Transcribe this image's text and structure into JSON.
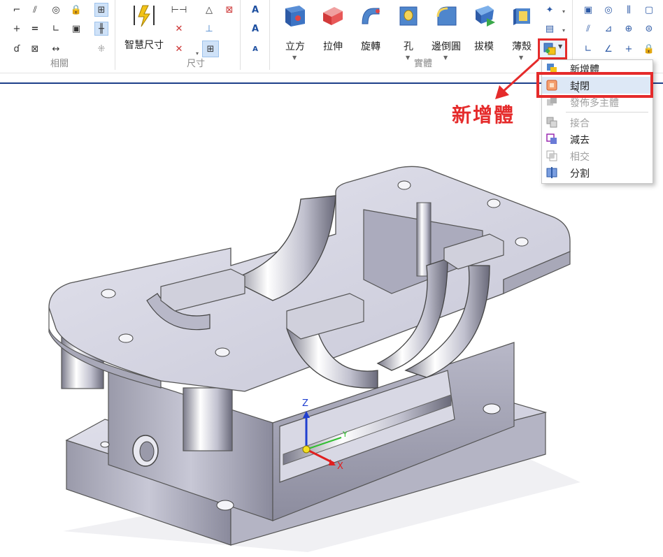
{
  "ribbon": {
    "groups": {
      "relations_label": "相關",
      "dimension_label": "尺寸",
      "solid_label": "實體"
    },
    "smart_dimension_label": "智慧尺寸",
    "solid_buttons": [
      {
        "label": "立方",
        "icon": "cube-icon"
      },
      {
        "label": "拉伸",
        "icon": "extrude-icon"
      },
      {
        "label": "旋轉",
        "icon": "revolve-icon"
      },
      {
        "label": "孔",
        "icon": "hole-icon"
      },
      {
        "label": "邊倒圓",
        "icon": "round-icon"
      },
      {
        "label": "拔模",
        "icon": "draft-icon"
      },
      {
        "label": "薄殼",
        "icon": "thin-wall-icon"
      }
    ]
  },
  "menu": {
    "items": [
      {
        "label": "新增體",
        "enabled": true
      },
      {
        "label": "封閉",
        "enabled": true,
        "hovered": true
      },
      {
        "label": "發佈多主體",
        "enabled": false
      },
      {
        "label": "接合",
        "enabled": false
      },
      {
        "label": "減去",
        "enabled": true
      },
      {
        "label": "相交",
        "enabled": false
      },
      {
        "label": "分割",
        "enabled": true
      }
    ]
  },
  "callout": {
    "text": "新增體"
  },
  "triad": {
    "x_label": "X",
    "y_label": "Y",
    "z_label": "Z"
  },
  "colors": {
    "highlight": "#e52b2b",
    "accent": "#1e3f8a"
  }
}
